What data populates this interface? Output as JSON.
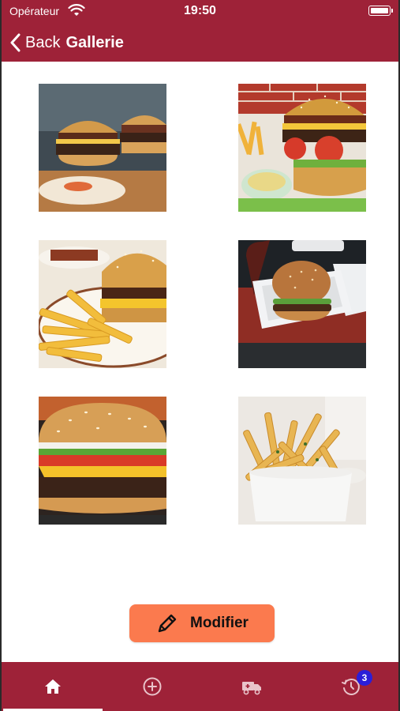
{
  "status_bar": {
    "carrier": "Opérateur",
    "time": "19:50"
  },
  "nav_bar": {
    "back_label": "Back",
    "title": "Gallerie"
  },
  "gallery": {
    "images": [
      {
        "icon": "burger-photo"
      },
      {
        "icon": "burger-fries-photo"
      },
      {
        "icon": "burger-fries-plate-photo"
      },
      {
        "icon": "burger-box-photo"
      },
      {
        "icon": "cheeseburger-photo"
      },
      {
        "icon": "fries-cup-photo"
      }
    ]
  },
  "modify_button": {
    "label": "Modifier",
    "icon": "pencil-icon"
  },
  "tab_bar": {
    "tabs": [
      {
        "icon": "home-icon",
        "active": true
      },
      {
        "icon": "add-circle-icon",
        "active": false
      },
      {
        "icon": "delivery-truck-icon",
        "active": false
      },
      {
        "icon": "history-icon",
        "active": false
      }
    ],
    "history_badge": "3"
  },
  "colors": {
    "primary": "#9e2238",
    "accent": "#fb7a4e",
    "badge": "#2b1ed8"
  }
}
